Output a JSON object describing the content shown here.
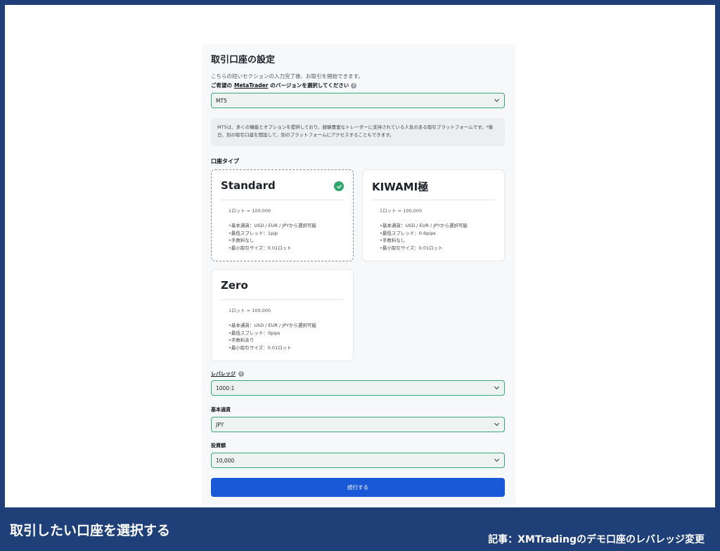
{
  "form": {
    "title": "取引口座の設定",
    "subtitle": "こちらの短いセクションの入力完了後、お取引を開始できます。",
    "prompt_prefix": "ご希望の",
    "prompt_link": "MetaTrader",
    "prompt_suffix": "のバージョンを選択してください",
    "platform_value": "MT5",
    "platform_note": "MT5は、多くの機能とオプションを提供しており、経験豊富なトレーダーに支持されている人気のある取引プラットフォームです。*後日、別の取引口座を開設して、別のプラットフォームにアクセスすることもできます。",
    "account_type_label": "口座タイプ",
    "cards": [
      {
        "name": "Standard",
        "lot": "1ロット = 100,000",
        "features": [
          "•基本通貨：USD / EUR / JPYから選択可能",
          "•最低スプレッド：1pip",
          "•手数料なし",
          "•最小取引サイズ：0.01ロット"
        ],
        "selected": true
      },
      {
        "name": "KIWAMI極",
        "lot": "1ロット = 100,000",
        "features": [
          "•基本通貨：USD / EUR / JPYから選択可能",
          "•最低スプレッド：0.6pips",
          "•手数料なし",
          "•最小取引サイズ：0.01ロット"
        ],
        "selected": false
      },
      {
        "name": "Zero",
        "lot": "1ロット = 100,000",
        "features": [
          "•基本通貨：USD / EUR / JPYから選択可能",
          "•最低スプレッド：0pips",
          "•手数料あり",
          "•最小取引サイズ：0.01ロット"
        ],
        "selected": false
      }
    ],
    "leverage_label": "レバレッジ",
    "leverage_value": "1000:1",
    "currency_label": "基本通貨",
    "currency_value": "JPY",
    "investment_label": "投資額",
    "investment_value": "10,000",
    "submit_label": "続行する"
  },
  "caption": {
    "left": "取引したい口座を選択する",
    "right": "記事：XMTradingのデモ口座のレバレッジ変更"
  },
  "colors": {
    "frame_border": "#1f3f78",
    "accent_green": "#3aa77a",
    "check_green": "#2ea56a",
    "button_blue": "#1958d6"
  },
  "icons": {
    "info": "info-icon",
    "check": "check-circle-icon",
    "dropdown": "chevron-down-icon"
  }
}
